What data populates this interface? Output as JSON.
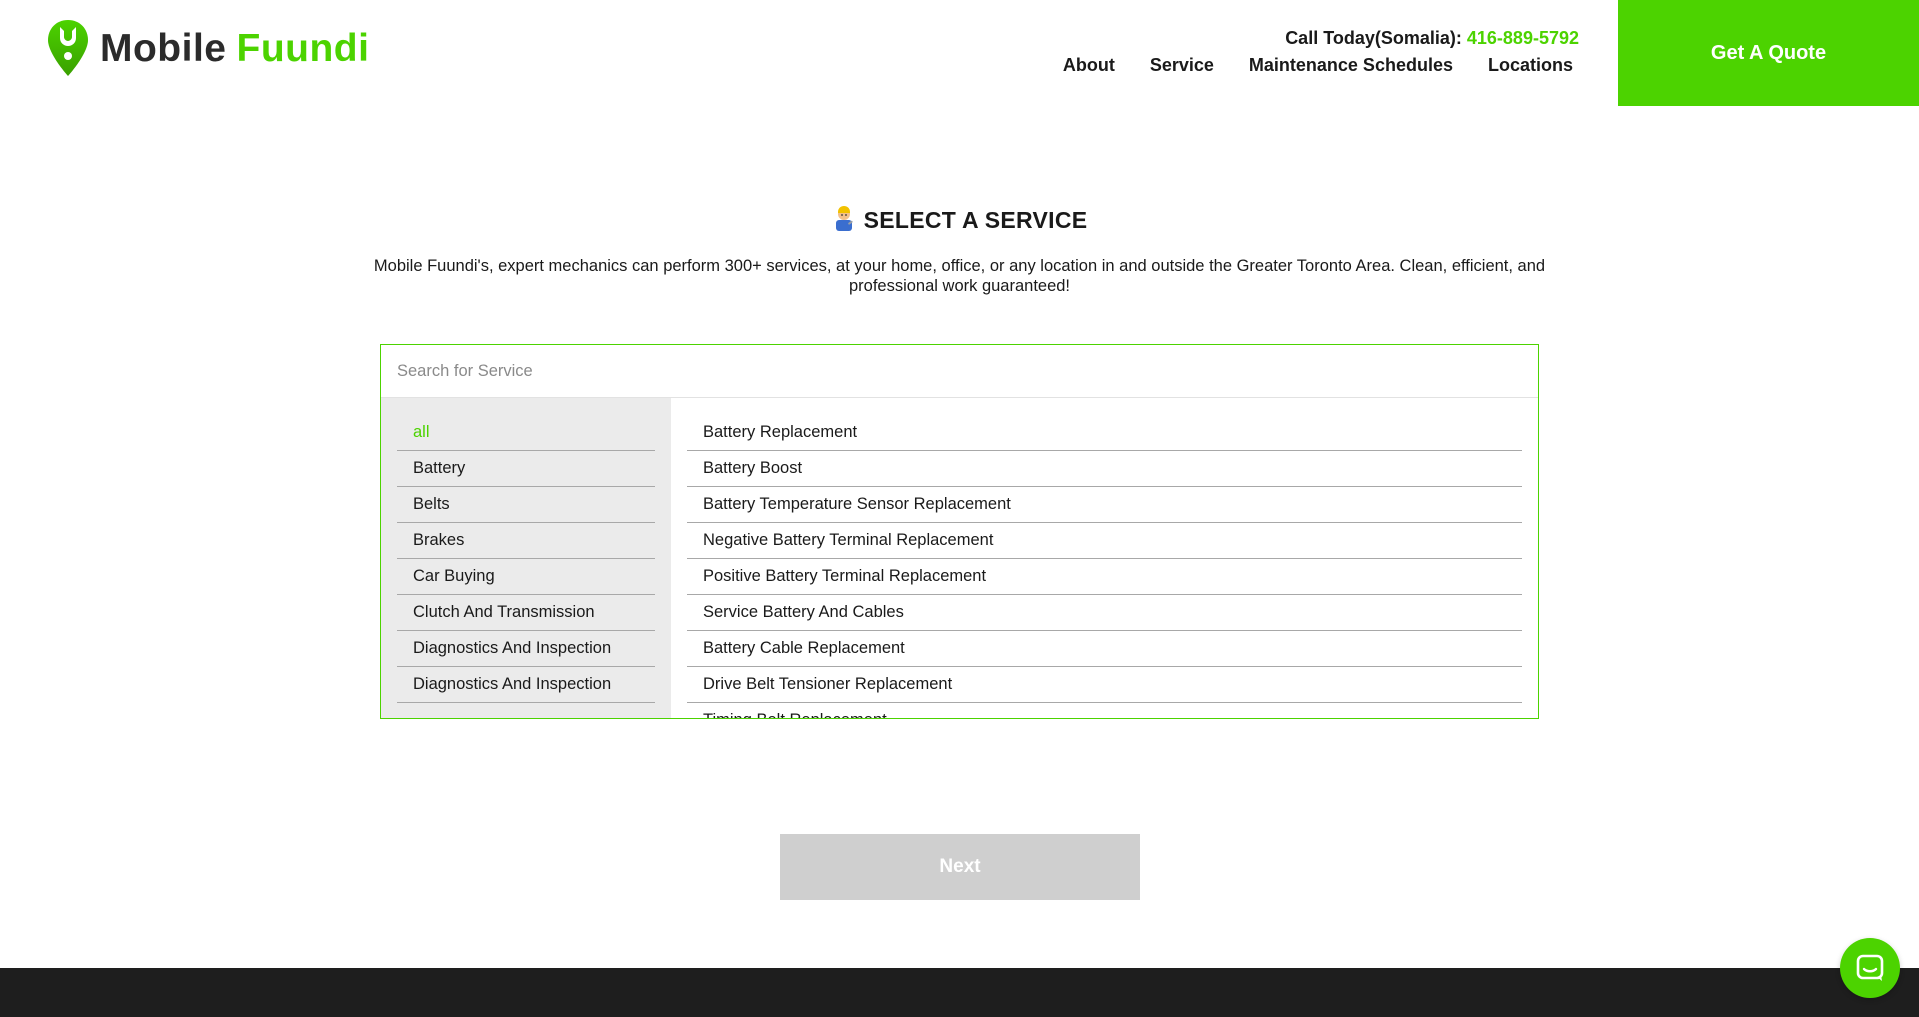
{
  "colors": {
    "accent": "#4cd300",
    "footer": "#1e1e1e",
    "next_disabled": "#cfcfcf",
    "category_bg": "#ebebeb"
  },
  "header": {
    "logo": {
      "word1": "Mobile",
      "word2": "Fuundi",
      "icon": "map-pin-wrench-icon"
    },
    "call": {
      "label": "Call Today(Somalia):",
      "phone": "416-889-5792"
    },
    "nav": [
      "About",
      "Service",
      "Maintenance Schedules",
      "Locations"
    ],
    "quote_button": "Get A Quote"
  },
  "main": {
    "title_icon": "mechanic-emoji-icon",
    "title": "SELECT A SERVICE",
    "intro": "Mobile Fuundi's, expert mechanics can perform 300+ services, at your home, office, or any location in and outside the Greater Toronto Area. Clean, efficient, and professional work guaranteed!",
    "search": {
      "placeholder": "Search for Service",
      "value": ""
    },
    "categories": [
      "all",
      "Battery",
      "Belts",
      "Brakes",
      "Car Buying",
      "Clutch And Transmission",
      "Diagnostics And Inspection",
      "Diagnostics And Inspection"
    ],
    "selected_category": "all",
    "services": [
      "Battery Replacement",
      "Battery Boost",
      "Battery Temperature Sensor Replacement",
      "Negative Battery Terminal Replacement",
      "Positive Battery Terminal Replacement",
      "Service Battery And Cables",
      "Battery Cable Replacement",
      "Drive Belt Tensioner Replacement",
      "Timing Belt Replacement"
    ],
    "next_button": "Next"
  },
  "chat": {
    "icon": "chat-bubble-icon"
  }
}
